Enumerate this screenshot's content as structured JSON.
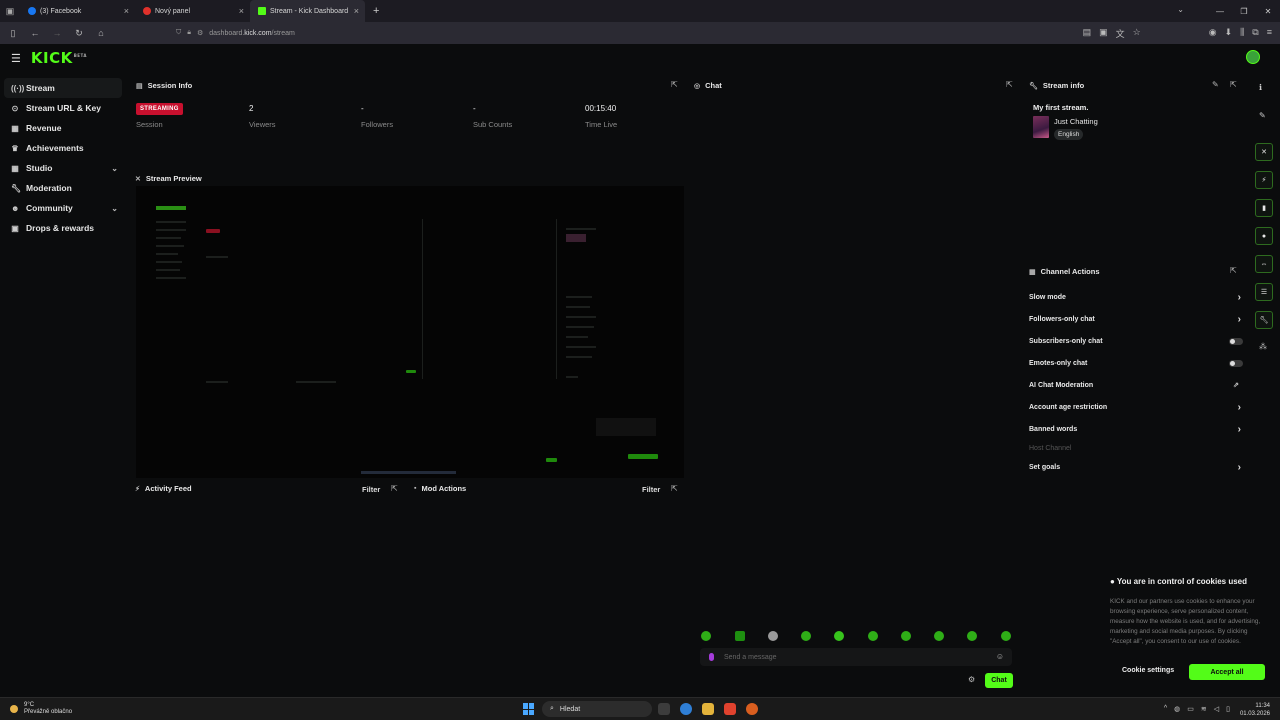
{
  "browser": {
    "tabs": [
      {
        "label": "(3) Facebook",
        "active": false,
        "color": "#1877f2"
      },
      {
        "label": "Nový panel",
        "active": false,
        "color": "#e0312b"
      },
      {
        "label": "Stream - Kick Dashboard",
        "active": true,
        "color": "#53fc18"
      }
    ],
    "new_tab": "+",
    "url_prefix": "dashboard.",
    "url_domain": "kick.com",
    "url_path": "/stream"
  },
  "brand": {
    "logo": "KICK",
    "beta": "BETA",
    "accent": "#53fc18"
  },
  "sidebar": {
    "items": [
      {
        "label": "Stream",
        "icon": "stream-icon",
        "active": true
      },
      {
        "label": "Stream URL & Key",
        "icon": "key-icon"
      },
      {
        "label": "Revenue",
        "icon": "revenue-icon"
      },
      {
        "label": "Achievements",
        "icon": "trophy-icon"
      },
      {
        "label": "Studio",
        "icon": "studio-icon",
        "expandable": true
      },
      {
        "label": "Moderation",
        "icon": "wrench-icon"
      },
      {
        "label": "Community",
        "icon": "community-icon",
        "expandable": true
      },
      {
        "label": "Drops & rewards",
        "icon": "gift-icon"
      }
    ]
  },
  "session_info": {
    "title": "Session Info",
    "status_badge": "STREAMING",
    "stats": [
      {
        "value": "",
        "label": "Session"
      },
      {
        "value": "2",
        "label": "Viewers"
      },
      {
        "value": "-",
        "label": "Followers"
      },
      {
        "value": "-",
        "label": "Sub Counts"
      },
      {
        "value": "00:15:40",
        "label": "Time Live"
      }
    ]
  },
  "stream_preview": {
    "title": "Stream Preview"
  },
  "activity_feed": {
    "title": "Activity Feed",
    "filter": "Filter"
  },
  "mod_actions": {
    "title": "Mod Actions",
    "filter": "Filter"
  },
  "chat": {
    "title": "Chat",
    "input_placeholder": "Send a message",
    "send_label": "Chat"
  },
  "stream_info": {
    "title": "Stream info",
    "stream_title": "My first stream.",
    "category": "Just Chatting",
    "language": "English"
  },
  "channel_actions": {
    "title": "Channel Actions",
    "items": [
      {
        "label": "Slow mode",
        "control": "chevron"
      },
      {
        "label": "Followers-only chat",
        "control": "chevron"
      },
      {
        "label": "Subscribers-only chat",
        "control": "toggle",
        "on": false
      },
      {
        "label": "Emotes-only chat",
        "control": "toggle",
        "on": false
      },
      {
        "label": "AI Chat Moderation",
        "control": "external"
      },
      {
        "label": "Account age restriction",
        "control": "chevron"
      },
      {
        "label": "Banned words",
        "control": "chevron"
      },
      {
        "label": "Host Channel",
        "control": "none",
        "disabled": true
      },
      {
        "label": "Set goals",
        "control": "chevron"
      }
    ]
  },
  "cookie_banner": {
    "title": "You are in control of cookies used",
    "body": "KICK and our partners use cookies to enhance your browsing experience, serve personalized content, measure how the website is used, and for advertising, marketing and social media purposes. By clicking \"Accept all\", you consent to our use of cookies.",
    "settings_label": "Cookie settings",
    "accept_label": "Accept all"
  },
  "taskbar": {
    "temperature": "9°C",
    "weather": "Převážně oblačno",
    "search": "Hledat",
    "time": "11:34",
    "date": "01.03.2026"
  }
}
